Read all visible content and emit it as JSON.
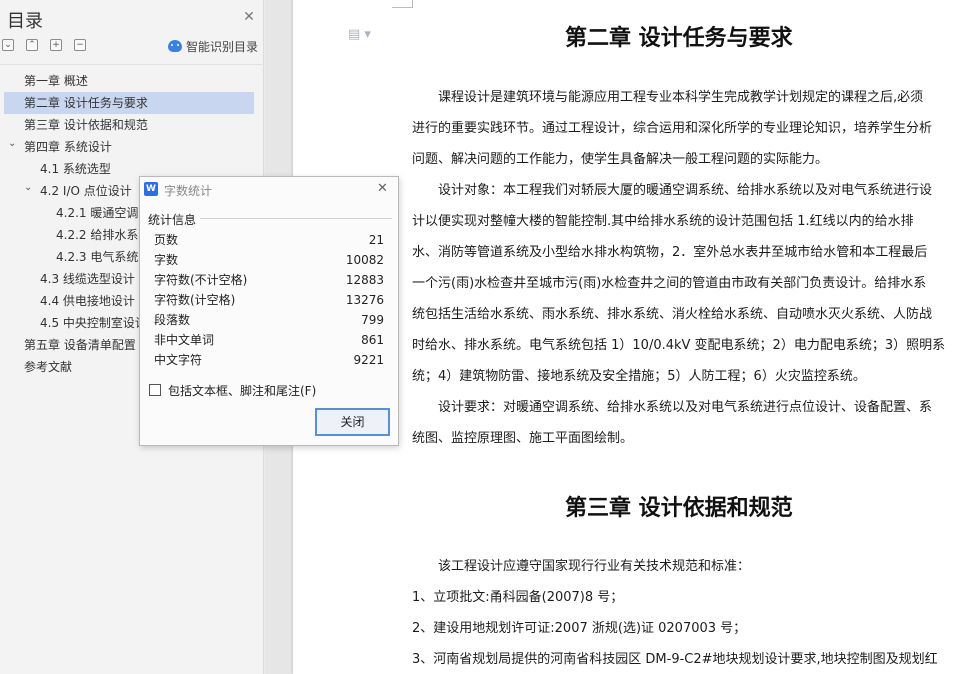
{
  "sidebar": {
    "title": "目录",
    "smart_recognize": "智能识别目录",
    "toolbar": [
      "⌄",
      "⌃",
      "+",
      "−"
    ],
    "items": [
      {
        "label": "第一章  概述",
        "level": 1,
        "selected": false
      },
      {
        "label": "第二章  设计任务与要求",
        "level": 1,
        "selected": true
      },
      {
        "label": "第三章  设计依据和规范",
        "level": 1,
        "selected": false
      },
      {
        "label": "第四章  系统设计",
        "level": 1,
        "selected": false,
        "expanded": true
      },
      {
        "label": "4.1 系统选型",
        "level": 2,
        "selected": false
      },
      {
        "label": "4.2 I/O 点位设计",
        "level": 2,
        "selected": false,
        "expanded": true
      },
      {
        "label": "4.2.1 暖通空调系统",
        "level": 3,
        "selected": false
      },
      {
        "label": "4.2.2 给排水系统",
        "level": 3,
        "selected": false
      },
      {
        "label": "4.2.3 电气系统",
        "level": 3,
        "selected": false
      },
      {
        "label": "4.3 线缆选型设计",
        "level": 2,
        "selected": false
      },
      {
        "label": "4.4 供电接地设计",
        "level": 2,
        "selected": false
      },
      {
        "label": "4.5 中央控制室设计",
        "level": 2,
        "selected": false
      },
      {
        "label": "第五章  设备清单配置",
        "level": 1,
        "selected": false
      },
      {
        "label": "参考文献",
        "level": 1,
        "selected": false
      }
    ]
  },
  "dialog": {
    "title": "字数统计",
    "logo": "W",
    "section_label": "统计信息",
    "rows": [
      {
        "label": "页数",
        "value": "21"
      },
      {
        "label": "字数",
        "value": "10082"
      },
      {
        "label": "字符数(不计空格)",
        "value": "12883"
      },
      {
        "label": "字符数(计空格)",
        "value": "13276"
      },
      {
        "label": "段落数",
        "value": "799"
      },
      {
        "label": "非中文单词",
        "value": "861"
      },
      {
        "label": "中文字符",
        "value": "9221"
      }
    ],
    "checkbox_label": "包括文本框、脚注和尾注(F)",
    "checkbox_checked": false,
    "close_button": "关闭"
  },
  "document": {
    "heading1": "第二章  设计任务与要求",
    "lines1": [
      "　　课程设计是建筑环境与能源应用工程专业本科学生完成教学计划规定的课程之后,必须",
      "进行的重要实践环节。通过工程设计，综合运用和深化所学的专业理论知识，培养学生分析",
      "问题、解决问题的工作能力，使学生具备解决一般工程问题的实际能力。",
      "　　设计对象：本工程我们对轿辰大厦的暖通空调系统、给排水系统以及对电气系统进行设",
      "计以便实现对整幢大楼的智能控制.其中给排水系统的设计范围包括 1.红线以内的给水排",
      "水、消防等管道系统及小型给水排水构筑物，2．室外总水表井至城市给水管和本工程最后",
      "一个污(雨)水检查井至城市污(雨)水检查井之间的管道由市政有关部门负责设计。给排水系",
      "统包括生活给水系统、雨水系统、排水系统、消火栓给水系统、自动喷水灭火系统、人防战",
      "时给水、排水系统。电气系统包括 1）10/0.4kV 变配电系统；2）电力配电系统；3）照明系",
      "统；4）建筑物防雷、接地系统及安全措施；5）人防工程；6）火灾监控系统。",
      "　　设计要求：对暖通空调系统、给排水系统以及对电气系统进行点位设计、设备配置、系",
      "统图、监控原理图、施工平面图绘制。"
    ],
    "heading2": "第三章  设计依据和规范",
    "lines2": [
      "　　该工程设计应遵守国家现行行业有关技术规范和标准：",
      "1、立项批文:甬科园备(2007)8 号；",
      "2、建设用地规划许可证:2007 浙规(选)证 0207003 号；",
      "3、河南省规划局提供的河南省科技园区 DM-9-C2#地块规划设计要求,地块控制图及规划红"
    ]
  }
}
